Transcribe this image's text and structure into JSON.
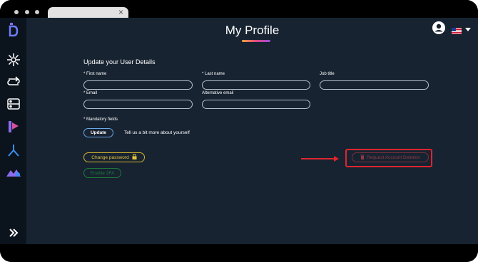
{
  "browser": {
    "tab_close_glyph": "×"
  },
  "sidebar": {
    "items": [
      {
        "icon": "app-logo-icon"
      },
      {
        "icon": "snowflake-icon"
      },
      {
        "icon": "loop-arrows-icon"
      },
      {
        "icon": "server-icon"
      },
      {
        "icon": "presentation-icon"
      },
      {
        "icon": "branch-icon"
      },
      {
        "icon": "mountains-icon"
      },
      {
        "icon": "expand-chevrons-icon"
      }
    ]
  },
  "header": {
    "title": "My Profile",
    "avatar_icon": "user-avatar-icon",
    "flag_icon": "us-flag-icon"
  },
  "form": {
    "section_title": "Update your User Details",
    "first_name_label": "* First name",
    "first_name_value": "",
    "last_name_label": "* Last name",
    "last_name_value": "",
    "job_title_label": "Job title",
    "job_title_value": "",
    "email_label": "* Email",
    "email_value": "",
    "alt_email_label": "Alternative email",
    "alt_email_value": "",
    "mandatory_note": "* Mandatory fields",
    "update_label": "Update",
    "hint": "Tell us a bit more about yourself"
  },
  "actions": {
    "change_password_label": "Change password",
    "enable_2fa_label": "Enable 2FA",
    "delete_label": "Request Account Deletion"
  },
  "colors": {
    "background": "#172331",
    "sidebar": "#0b141d",
    "password_accent": "#e6c43a",
    "twofa_accent": "#1e7a36",
    "delete_accent": "#8f3a44",
    "annotation_red": "#e0252d",
    "update_border": "#6aa8e8"
  }
}
